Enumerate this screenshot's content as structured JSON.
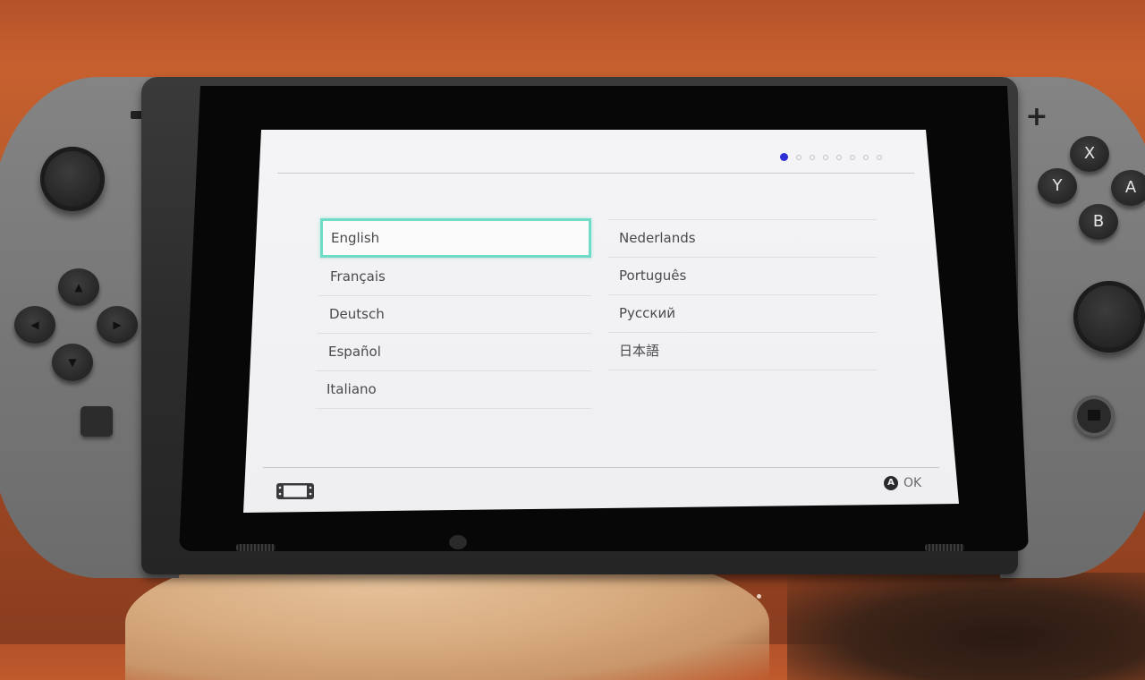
{
  "scene": {
    "device": "Nintendo Switch",
    "colors": {
      "table": "#b85a2c",
      "joycon": "#7a7a7a",
      "bezel": "#070707",
      "screen_bg": "#f2f2f4",
      "selection_border": "#6fdcc8",
      "active_page_dot": "#2f2fd8"
    }
  },
  "joycon_left": {
    "buttons": [
      {
        "name": "minus",
        "glyph": ""
      },
      {
        "name": "dpad-up",
        "glyph": "▲"
      },
      {
        "name": "dpad-left",
        "glyph": "◀"
      },
      {
        "name": "dpad-right",
        "glyph": "▶"
      },
      {
        "name": "dpad-down",
        "glyph": "▼"
      },
      {
        "name": "capture",
        "glyph": ""
      }
    ]
  },
  "joycon_right": {
    "plus_glyph": "+",
    "buttons": [
      {
        "name": "x",
        "label": "X"
      },
      {
        "name": "y",
        "label": "Y"
      },
      {
        "name": "a",
        "label": "A"
      },
      {
        "name": "b",
        "label": "B"
      }
    ]
  },
  "screen": {
    "pagination": {
      "total_steps": 8,
      "current_step": 1
    },
    "languages_left": [
      {
        "label": "English",
        "selected": true
      },
      {
        "label": "Français",
        "selected": false
      },
      {
        "label": "Deutsch",
        "selected": false
      },
      {
        "label": "Español",
        "selected": false
      },
      {
        "label": "Italiano",
        "selected": false
      }
    ],
    "languages_right": [
      {
        "label": "Nederlands",
        "selected": false
      },
      {
        "label": "Português",
        "selected": false
      },
      {
        "label": "Русский",
        "selected": false
      },
      {
        "label": "日本語",
        "selected": false
      }
    ],
    "footer": {
      "console_icon": "handheld-console-icon",
      "confirm_button_glyph": "A",
      "confirm_label": "OK"
    }
  }
}
